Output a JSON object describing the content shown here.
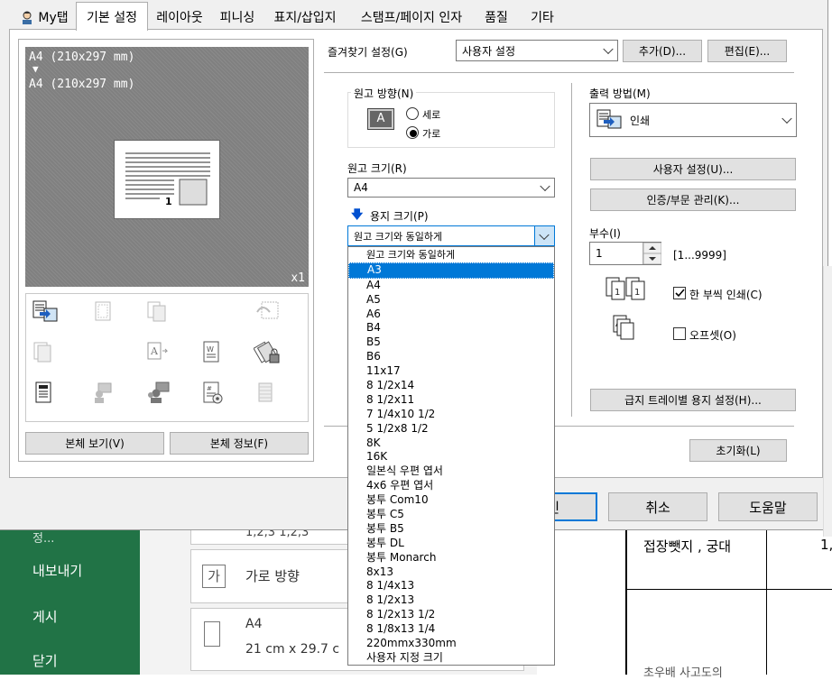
{
  "tabs": [
    {
      "label": "My탭"
    },
    {
      "label": "기본 설정"
    },
    {
      "label": "레이아웃"
    },
    {
      "label": "피니싱"
    },
    {
      "label": "표지/삽입지"
    },
    {
      "label": "스탬프/페이지 인자"
    },
    {
      "label": "품질"
    },
    {
      "label": "기타"
    }
  ],
  "preview": {
    "line1": "A4 (210x297 mm)",
    "arrow": "▼",
    "line2": "A4 (210x297 mm)",
    "copies_badge": "x1",
    "page_number": "1"
  },
  "left_buttons": {
    "view": "본체 보기(V)",
    "info": "본체 정보(F)"
  },
  "favorites": {
    "label": "즐겨찾기 설정(G)",
    "value": "사용자 설정",
    "add": "추가(D)...",
    "edit": "편집(E)..."
  },
  "orientation": {
    "legend": "원고 방향(N)",
    "portrait": "세로",
    "landscape": "가로",
    "selected": "landscape"
  },
  "original_size": {
    "label": "원고 크기(R)",
    "value": "A4"
  },
  "paper_size": {
    "label": "용지 크기(P)",
    "value": "원고 크기와 동일하게",
    "options": [
      "원고 크기와 동일하게",
      "A3",
      "A4",
      "A5",
      "A6",
      "B4",
      "B5",
      "B6",
      "11x17",
      "8 1/2x14",
      "8 1/2x11",
      "7 1/4x10 1/2",
      "5 1/2x8 1/2",
      "8K",
      "16K",
      "일본식 우편 엽서",
      "4x6 우편 엽서",
      "봉투 Com10",
      "봉투 C5",
      "봉투 B5",
      "봉투 DL",
      "봉투 Monarch",
      "8x13",
      "8 1/4x13",
      "8 1/2x13",
      "8 1/2x13 1/2",
      "8 1/8x13 1/4",
      "220mmx330mm",
      "사용자 지정 크기"
    ],
    "highlighted": "A3"
  },
  "output": {
    "label": "출력 방법(M)",
    "value": "인쇄",
    "user_settings": "사용자 설정(U)...",
    "auth": "인증/부문 관리(K)..."
  },
  "copies": {
    "label": "부수(I)",
    "value": "1",
    "range": "[1...9999]",
    "collate": "한 부씩 인쇄(C)",
    "offset": "오프셋(O)",
    "collate_checked": true,
    "offset_checked": false
  },
  "tray_button": "급지 트레이별 용지 설정(H)...",
  "reset_button": "초기화(L)",
  "dialog_buttons": {
    "ok_fragment": "인",
    "cancel": "취소",
    "help": "도움말"
  },
  "background": {
    "nav": [
      "내보내기",
      "게시",
      "닫기"
    ],
    "nav_partial": "정...",
    "collate_text": "1,2,3    1,2,3",
    "orientation_icon": "가",
    "orientation_text": "가로 방향",
    "size_title": "A4",
    "size_desc": "21 cm x 29.7 c",
    "cell_text": "접장뺏지 , 궁대",
    "cell_text2": "1,",
    "bottom_text": "초우배 사고도의"
  }
}
